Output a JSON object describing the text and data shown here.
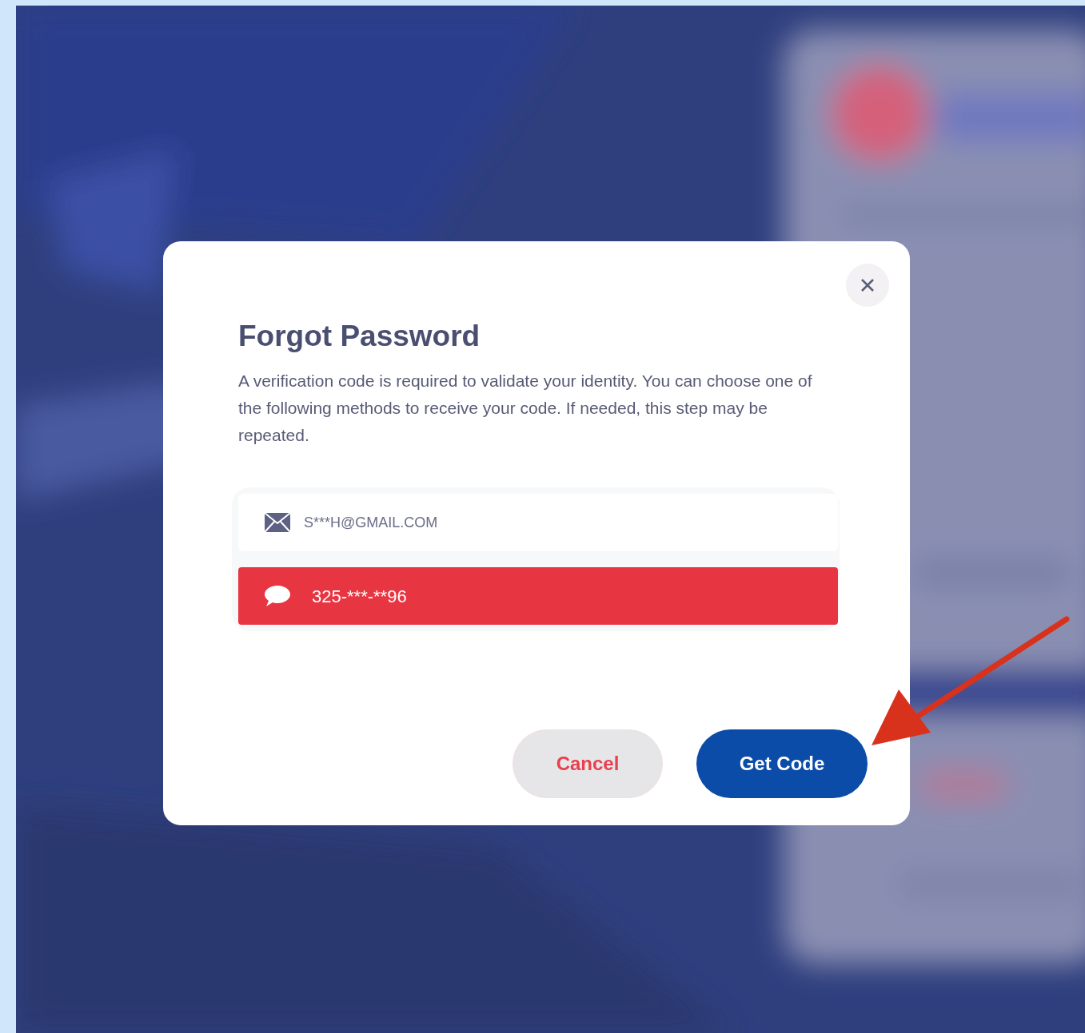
{
  "dialog": {
    "title": "Forgot Password",
    "description": "A verification code is required to validate your identity. You can choose one of the following methods to receive your code. If needed, this step may be repeated.",
    "methods": [
      {
        "kind": "email",
        "label": "S***H@GMAIL.COM",
        "selected": false
      },
      {
        "kind": "sms",
        "label": "325-***-**96",
        "selected": true
      }
    ],
    "buttons": [
      {
        "kind": "secondary",
        "label": "Cancel"
      },
      {
        "kind": "primary",
        "label": "Get Code"
      }
    ]
  }
}
